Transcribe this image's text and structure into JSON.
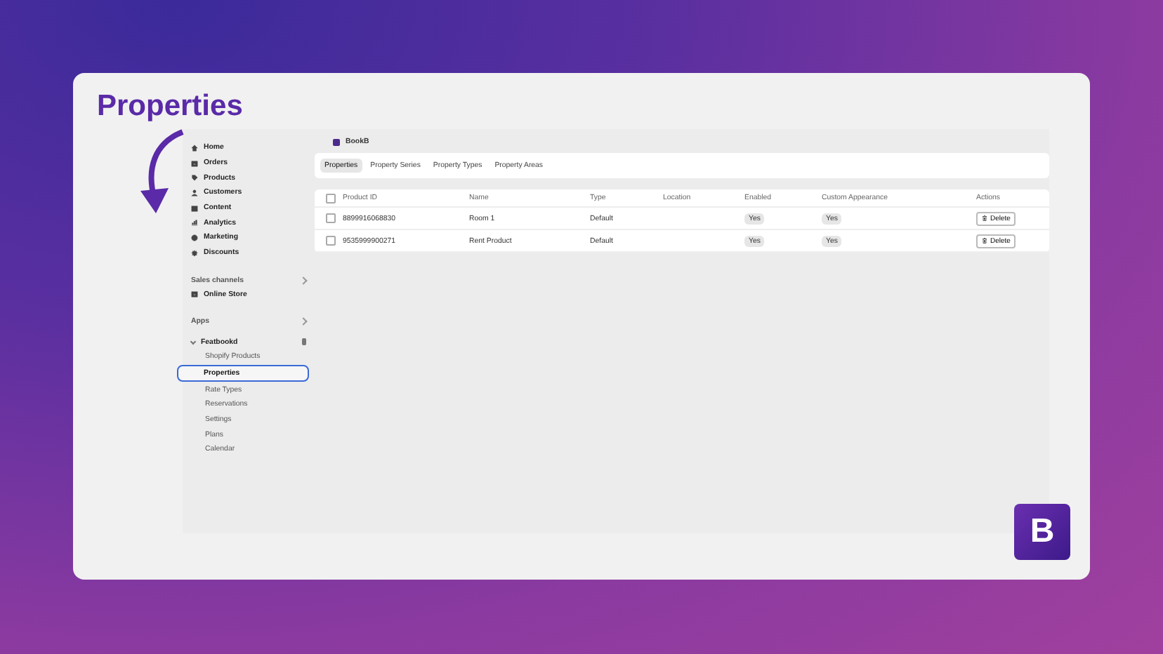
{
  "headline": "Properties",
  "sidebar": {
    "items": [
      {
        "label": "Home"
      },
      {
        "label": "Orders"
      },
      {
        "label": "Products"
      },
      {
        "label": "Customers"
      },
      {
        "label": "Content"
      },
      {
        "label": "Analytics"
      },
      {
        "label": "Marketing"
      },
      {
        "label": "Discounts"
      }
    ],
    "sections": [
      {
        "title": "Sales channels",
        "items": [
          {
            "label": "Online Store"
          }
        ]
      },
      {
        "title": "Apps"
      }
    ],
    "app": {
      "label": "Featbookd",
      "expanded": true,
      "children": [
        {
          "label": "Shopify Products",
          "selected": false
        },
        {
          "label": "Properties",
          "selected": true
        },
        {
          "label": "Rate Types",
          "selected": false
        },
        {
          "label": "Reservations",
          "selected": false
        },
        {
          "label": "Settings",
          "selected": false
        },
        {
          "label": "Plans",
          "selected": false
        },
        {
          "label": "Calendar",
          "selected": false
        }
      ]
    }
  },
  "app_header": {
    "title": "BookB"
  },
  "tabs": [
    {
      "label": "Properties",
      "selected": true
    },
    {
      "label": "Property Series",
      "selected": false
    },
    {
      "label": "Property Types",
      "selected": false
    },
    {
      "label": "Property Areas",
      "selected": false
    }
  ],
  "table": {
    "select_all_checked": false,
    "columns": [
      "Product ID",
      "Name",
      "Type",
      "Location",
      "Enabled",
      "Custom Appearance",
      "Actions"
    ],
    "rows": [
      {
        "checked": false,
        "cells": [
          "8899916068830",
          "Room 1",
          "Default",
          "",
          "Yes",
          "Yes"
        ],
        "action": "Delete"
      },
      {
        "checked": false,
        "cells": [
          "9535999900271",
          "Rent Product",
          "Default",
          "",
          "Yes",
          "Yes"
        ],
        "action": "Delete"
      }
    ]
  },
  "logo": {
    "letter": "B"
  }
}
